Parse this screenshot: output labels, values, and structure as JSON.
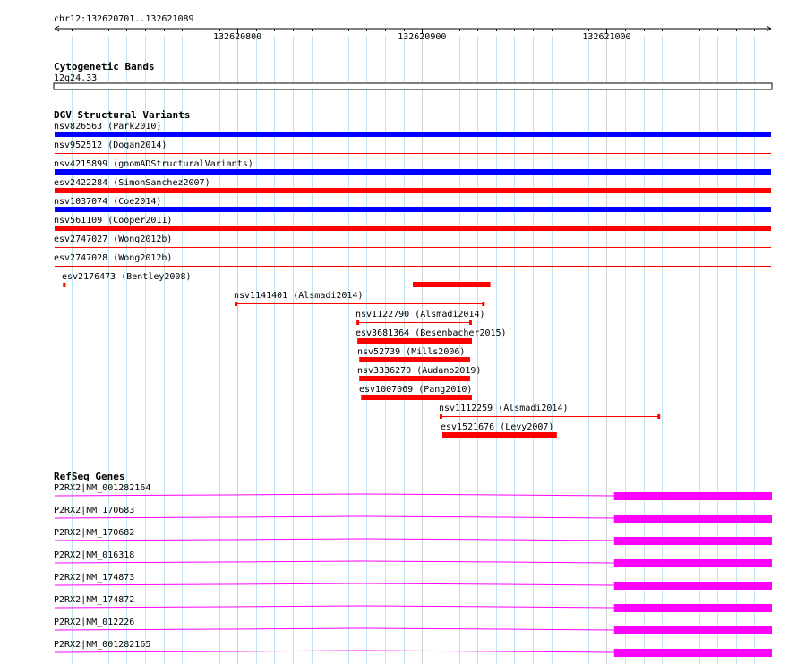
{
  "region": {
    "label": "chr12:132620701..132621089",
    "start": 132620701,
    "end": 132621089,
    "ticks": [
      {
        "pos": 132620800,
        "label": "132620800"
      },
      {
        "pos": 132620900,
        "label": "132620900"
      },
      {
        "pos": 132621000,
        "label": "132621000"
      }
    ]
  },
  "tracks": {
    "cytoband": {
      "title": "Cytogenetic Bands",
      "band": "12q24.33"
    },
    "dgv": {
      "title": "DGV Structural Variants",
      "color_loss": "#ff0000",
      "color_gain": "#0000ff",
      "features": [
        {
          "label": "nsv826563 (Park2010)",
          "start": 132620701,
          "end": 132621089,
          "color": "#0000ff",
          "style": "thick"
        },
        {
          "label": "nsv952512 (Dogan2014)",
          "start": 132620701,
          "end": 132621089,
          "color": "#ff0000",
          "style": "thin"
        },
        {
          "label": "nsv4215899 (gnomADStructuralVariants)",
          "start": 132620701,
          "end": 132621089,
          "color": "#0000ff",
          "style": "thick"
        },
        {
          "label": "esv2422284 (SimonSanchez2007)",
          "start": 132620701,
          "end": 132621089,
          "color": "#ff0000",
          "style": "thick"
        },
        {
          "label": "nsv1037074 (Coe2014)",
          "start": 132620701,
          "end": 132621089,
          "color": "#0000ff",
          "style": "thick"
        },
        {
          "label": "nsv561109 (Cooper2011)",
          "start": 132620701,
          "end": 132621089,
          "color": "#ff0000",
          "style": "thick"
        },
        {
          "label": "esv2747027 (Wong2012b)",
          "start": 132620701,
          "end": 132621089,
          "color": "#ff0000",
          "style": "thin"
        },
        {
          "label": "esv2747028 (Wong2012b)",
          "start": 132620701,
          "end": 132621089,
          "color": "#ff0000",
          "style": "thin"
        },
        {
          "label": "esv2176473 (Bentley2008)",
          "start": 132620706,
          "end": 132621089,
          "color": "#ff0000",
          "style": "thin",
          "inner_start": 132620895,
          "inner_end": 132620937
        },
        {
          "label": "nsv1141401 (Alsmadi2014)",
          "start": 132620799,
          "end": 132620933,
          "color": "#ff0000",
          "style": "thin"
        },
        {
          "label": "nsv1122790 (Alsmadi2014)",
          "start": 132620865,
          "end": 132620926,
          "color": "#ff0000",
          "style": "thin"
        },
        {
          "label": "esv3681364 (Besenbacher2015)",
          "start": 132620865,
          "end": 132620927,
          "color": "#ff0000",
          "style": "thick"
        },
        {
          "label": "nsv52739 (Mills2006)",
          "start": 132620866,
          "end": 132620926,
          "color": "#ff0000",
          "style": "thick"
        },
        {
          "label": "nsv3336270 (Audano2019)",
          "start": 132620866,
          "end": 132620926,
          "color": "#ff0000",
          "style": "thick"
        },
        {
          "label": "esv1007069 (Pang2010)",
          "start": 132620867,
          "end": 132620927,
          "color": "#ff0000",
          "style": "thick"
        },
        {
          "label": "nsv1112259 (Alsmadi2014)",
          "start": 132620910,
          "end": 132621028,
          "color": "#ff0000",
          "style": "thin"
        },
        {
          "label": "esv1521676 (Levy2007)",
          "start": 132620911,
          "end": 132620973,
          "color": "#ff0000",
          "style": "thick"
        }
      ]
    },
    "refseq": {
      "title": "RefSeq Genes",
      "color": "#ff00ff",
      "exon_start": 132621004,
      "genes": [
        {
          "label": "P2RX2|NM_001282164"
        },
        {
          "label": "P2RX2|NM_170683"
        },
        {
          "label": "P2RX2|NM_170682"
        },
        {
          "label": "P2RX2|NM_016318"
        },
        {
          "label": "P2RX2|NM_174873"
        },
        {
          "label": "P2RX2|NM_174872"
        },
        {
          "label": "P2RX2|NM_012226"
        },
        {
          "label": "P2RX2|NM_001282165"
        }
      ]
    }
  }
}
